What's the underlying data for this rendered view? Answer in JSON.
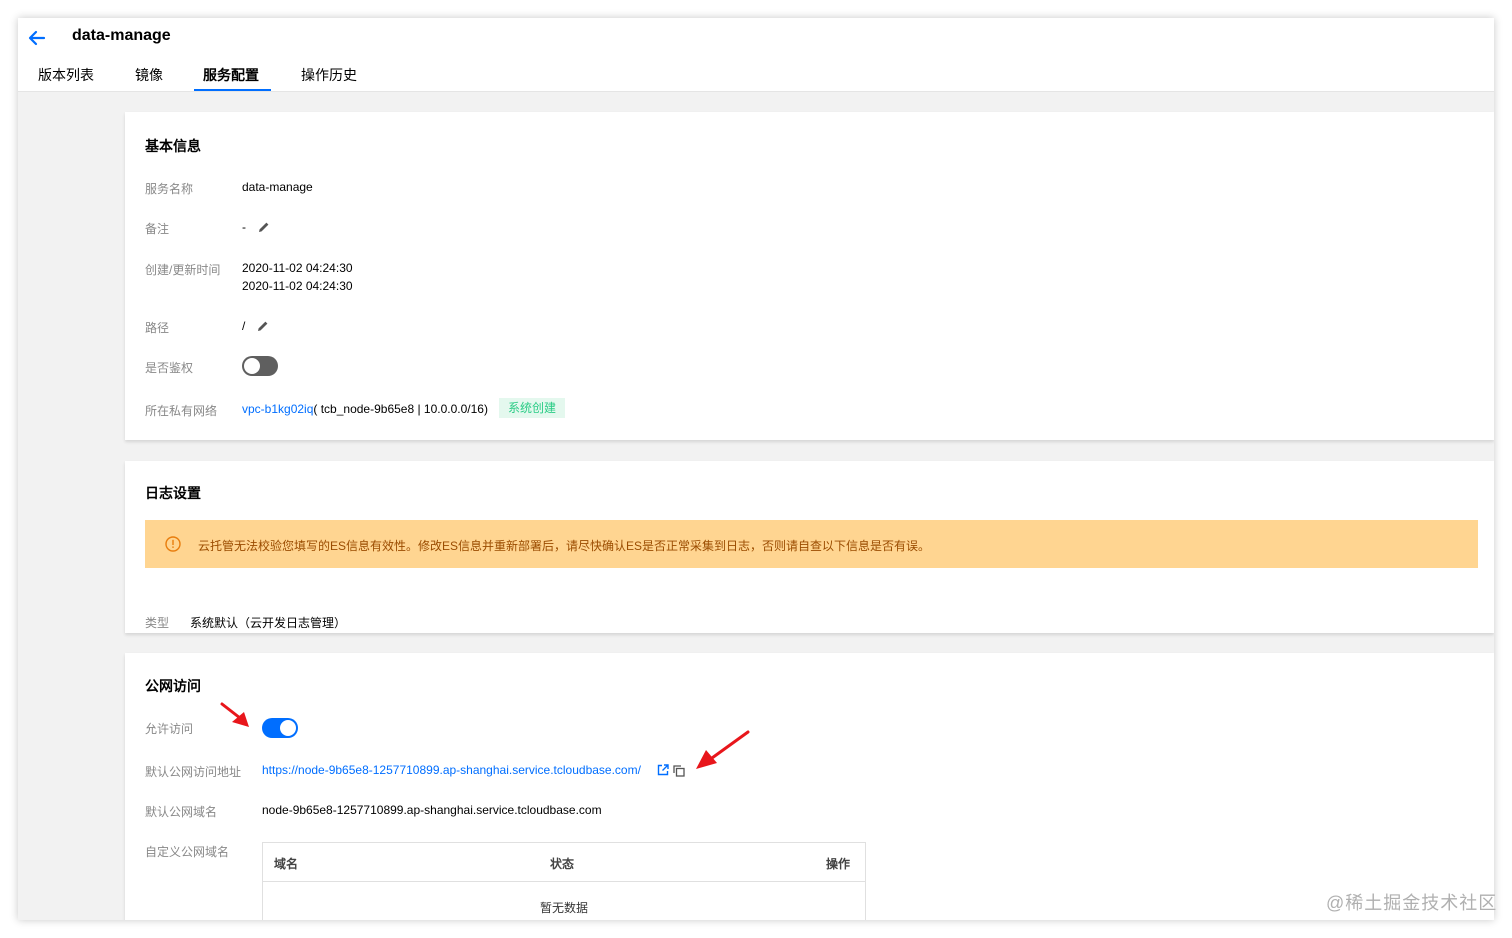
{
  "app": {
    "title": "data-manage"
  },
  "tabs": [
    {
      "label": "版本列表"
    },
    {
      "label": "镜像"
    },
    {
      "label": "服务配置",
      "active": true
    },
    {
      "label": "操作历史"
    }
  ],
  "basic_info": {
    "title": "基本信息",
    "service_name_label": "服务名称",
    "service_name_value": "data-manage",
    "remark_label": "备注",
    "remark_value": "-",
    "time_label": "创建/更新时间",
    "created_time": "2020-11-02 04:24:30",
    "updated_time": "2020-11-02 04:24:30",
    "path_label": "路径",
    "path_value": "/",
    "auth_label": "是否鉴权",
    "auth_enabled": false,
    "vpc_label": "所在私有网络",
    "vpc_id": "vpc-b1kg02iq",
    "vpc_detail": "( tcb_node-9b65e8 | 10.0.0.0/16)",
    "vpc_badge": "系统创建"
  },
  "log_settings": {
    "title": "日志设置",
    "warning_text": "云托管无法校验您填写的ES信息有效性。修改ES信息并重新部署后，请尽快确认ES是否正常采集到日志，否则请自查以下信息是否有误。",
    "type_label": "类型",
    "type_value": "系统默认（云开发日志管理）"
  },
  "public_access": {
    "title": "公网访问",
    "allow_label": "允许访问",
    "allow_enabled": true,
    "default_url_label": "默认公网访问地址",
    "default_url": "https://node-9b65e8-1257710899.ap-shanghai.service.tcloudbase.com/",
    "default_domain_label": "默认公网域名",
    "default_domain": "node-9b65e8-1257710899.ap-shanghai.service.tcloudbase.com",
    "custom_domain_label": "自定义公网域名",
    "table": {
      "columns": [
        "域名",
        "状态",
        "操作"
      ],
      "empty_text": "暂无数据"
    }
  },
  "watermark": "@稀土掘金技术社区",
  "colors": {
    "accent": "#006eff",
    "toggle_off": "#5f5f5f",
    "warning_bg": "#ffd591",
    "warning_text": "#9b4c00",
    "badge_text": "#29cc85",
    "badge_bg": "#e4f8ee",
    "annotation_arrow": "#e8161b"
  }
}
